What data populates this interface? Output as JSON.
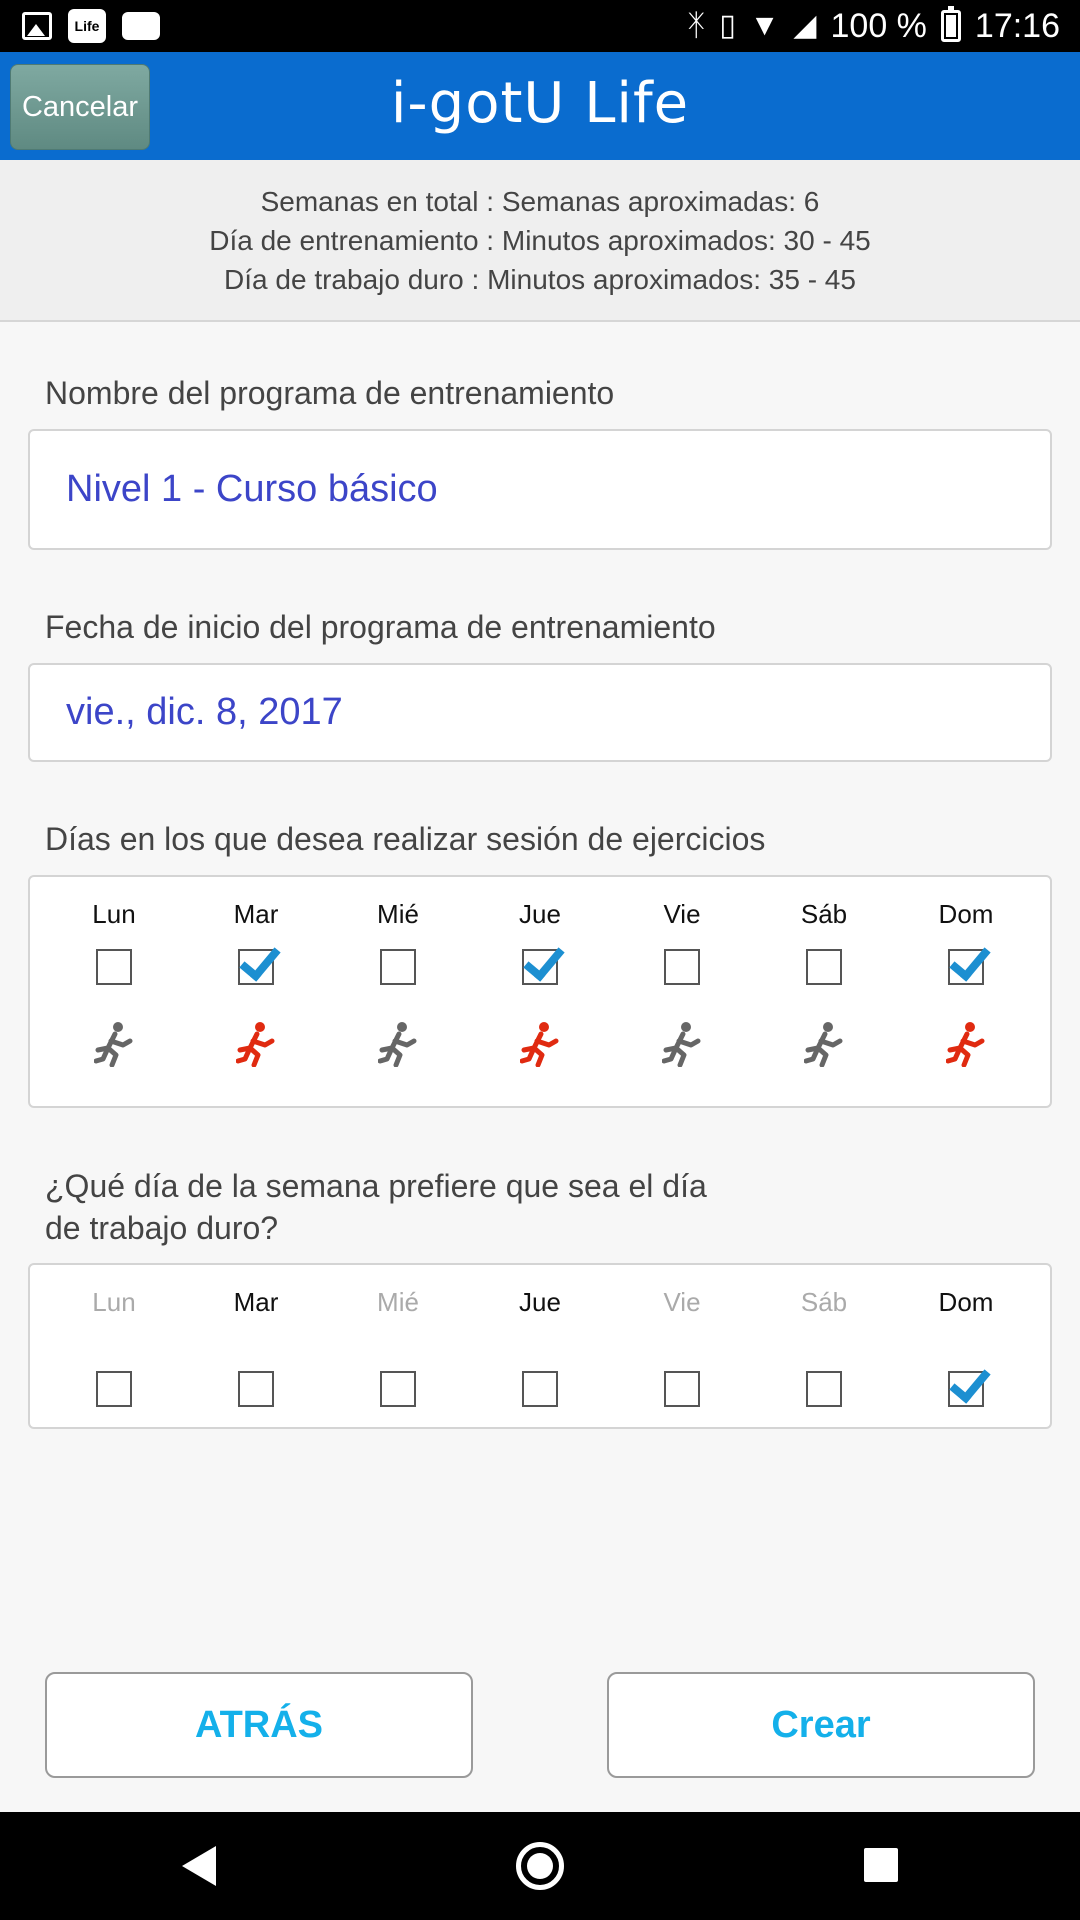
{
  "status_bar": {
    "left_icons": [
      "picture-icon",
      "life-app-icon",
      "message-icon"
    ],
    "life_badge": "Life",
    "battery": "100 %",
    "time": "17:16"
  },
  "header": {
    "cancel_label": "Cancelar",
    "app_title": "i-gotU Life",
    "bg_color": "#0a6ccf"
  },
  "summary": {
    "line1": "Semanas en total : Semanas aproximadas: 6",
    "line2": "Día de entrenamiento : Minutos aproximados: 30 - 45",
    "line3": "Día de trabajo duro : Minutos aproximados: 35 - 45"
  },
  "program_name": {
    "label": "Nombre del programa de entrenamiento",
    "value": "Nivel 1 - Curso básico"
  },
  "start_date": {
    "label": "Fecha de inicio del programa de entrenamiento",
    "value": "vie., dic. 8, 2017"
  },
  "exercise_days": {
    "label": "Días en los que desea realizar sesión de ejercicios",
    "days": [
      {
        "name": "Lun",
        "checked": false,
        "runner_color": "#666666"
      },
      {
        "name": "Mar",
        "checked": true,
        "runner_color": "#e02a10"
      },
      {
        "name": "Mié",
        "checked": false,
        "runner_color": "#666666"
      },
      {
        "name": "Jue",
        "checked": true,
        "runner_color": "#e02a10"
      },
      {
        "name": "Vie",
        "checked": false,
        "runner_color": "#666666"
      },
      {
        "name": "Sáb",
        "checked": false,
        "runner_color": "#666666"
      },
      {
        "name": "Dom",
        "checked": true,
        "runner_color": "#e02a10"
      }
    ]
  },
  "hard_day": {
    "label_line1": "¿Qué día de la semana prefiere que sea el día",
    "label_line2": "de trabajo duro?",
    "days": [
      {
        "name": "Lun",
        "enabled": false,
        "checked": false
      },
      {
        "name": "Mar",
        "enabled": true,
        "checked": false
      },
      {
        "name": "Mié",
        "enabled": false,
        "checked": false
      },
      {
        "name": "Jue",
        "enabled": true,
        "checked": false
      },
      {
        "name": "Vie",
        "enabled": false,
        "checked": false
      },
      {
        "name": "Sáb",
        "enabled": false,
        "checked": false
      },
      {
        "name": "Dom",
        "enabled": true,
        "checked": true
      }
    ]
  },
  "buttons": {
    "back_label": "ATRÁS",
    "create_label": "Crear",
    "accent_color": "#14b0ea"
  }
}
